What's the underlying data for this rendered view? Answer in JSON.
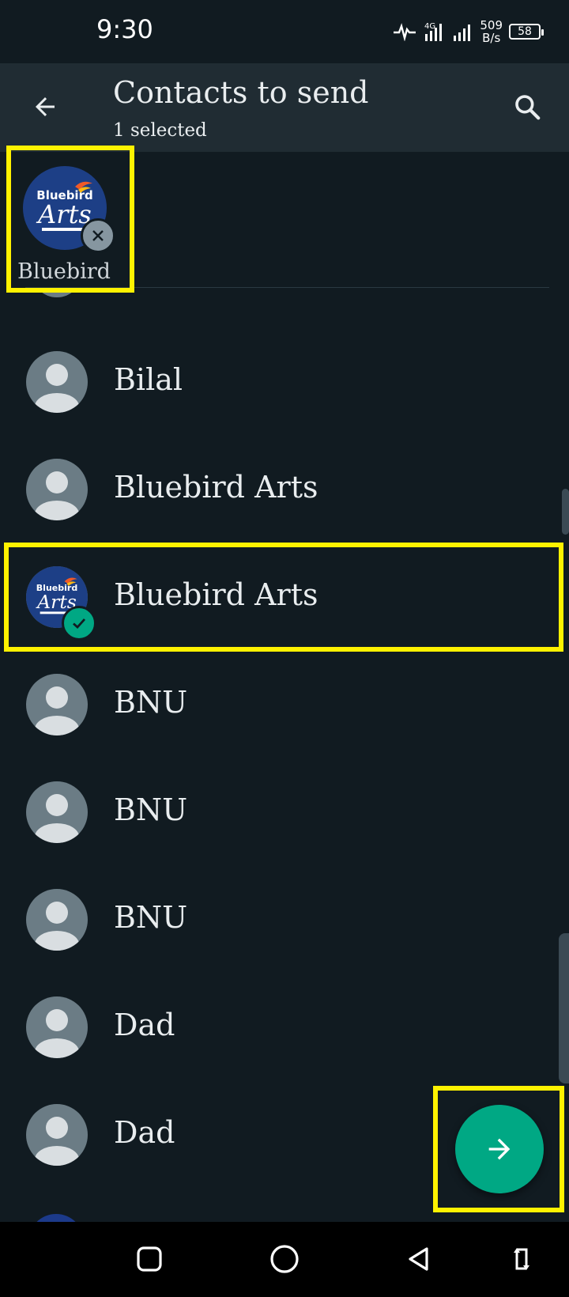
{
  "status_bar": {
    "time": "9:30",
    "network_label": "4G",
    "net_speed_value": "509",
    "net_speed_unit": "B/s",
    "battery": "58"
  },
  "header": {
    "title": "Contacts to send",
    "subtitle": "1 selected",
    "back_icon": "arrow-left-icon",
    "search_icon": "search-icon"
  },
  "selected": [
    {
      "name": "Bluebird",
      "logo_line1": "Bluebird",
      "logo_line2": "Arts",
      "remove_icon": "close-icon"
    }
  ],
  "contacts": [
    {
      "name": "Bilal",
      "avatar": "default"
    },
    {
      "name": "Bluebird Arts",
      "avatar": "default"
    },
    {
      "name": "Bluebird Arts",
      "avatar": "logo",
      "checked": true,
      "logo_line1": "Bluebird",
      "logo_line2": "Arts"
    },
    {
      "name": "BNU",
      "avatar": "default"
    },
    {
      "name": "BNU",
      "avatar": "default"
    },
    {
      "name": "BNU",
      "avatar": "default"
    },
    {
      "name": "Dad",
      "avatar": "default"
    },
    {
      "name": "Dad",
      "avatar": "default"
    }
  ],
  "fab": {
    "icon": "arrow-right-icon"
  },
  "nav": {
    "recents_icon": "square-icon",
    "home_icon": "circle-icon",
    "back_icon": "triangle-back-icon",
    "rotate_icon": "rotate-icon"
  },
  "colors": {
    "background": "#111b21",
    "header": "#202c33",
    "accent": "#00a884",
    "highlight": "#fff200"
  }
}
